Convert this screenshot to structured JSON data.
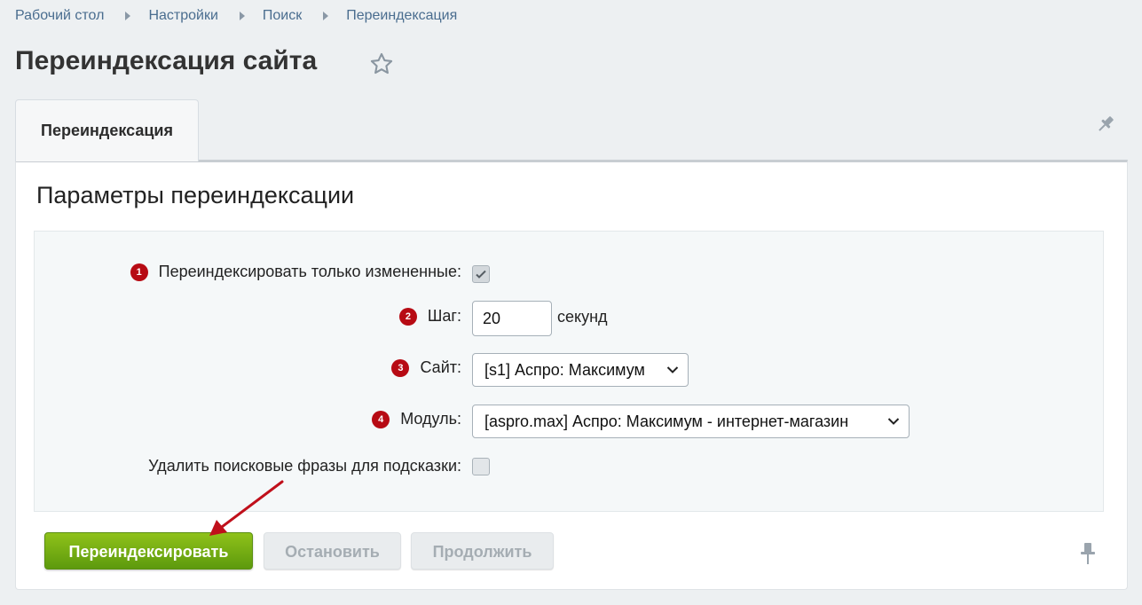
{
  "breadcrumb": [
    "Рабочий стол",
    "Настройки",
    "Поиск",
    "Переиндексация"
  ],
  "page_title": "Переиндексация сайта",
  "tab_label": "Переиндексация",
  "section_title": "Параметры переиндексации",
  "form": {
    "changed_only": {
      "badge": "1",
      "label": "Переиндексировать только измененные:",
      "checked": true
    },
    "step": {
      "badge": "2",
      "label": "Шаг:",
      "value": "20",
      "unit": "секунд"
    },
    "site": {
      "badge": "3",
      "label": "Сайт:",
      "value": "[s1] Аспро: Максимум"
    },
    "module": {
      "badge": "4",
      "label": "Модуль:",
      "value": "[aspro.max] Аспро: Максимум - интернет-магазин"
    },
    "delete_phrases": {
      "label": "Удалить поисковые фразы для подсказки:",
      "checked": false
    }
  },
  "buttons": {
    "reindex": "Переиндексировать",
    "stop": "Остановить",
    "continue": "Продолжить"
  },
  "colors": {
    "badge": "#b70b14",
    "primary_button": "#6fa913",
    "arrow": "#c0101b"
  }
}
